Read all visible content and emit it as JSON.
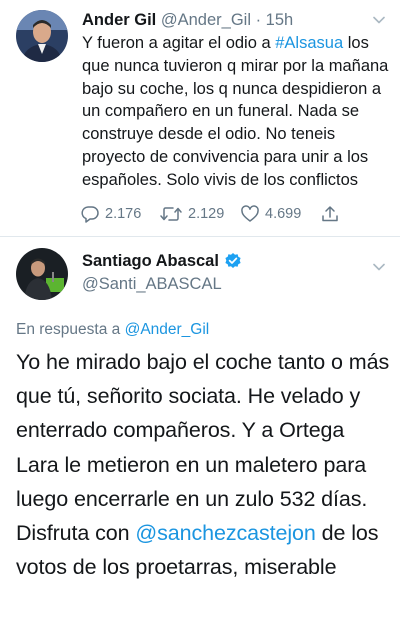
{
  "tweet1": {
    "author_name": "Ander Gil",
    "handle": "@Ander_Gil",
    "separator": "·",
    "time": "15h",
    "text_parts": {
      "before_tag": "Y fueron a agitar el odio a ",
      "hashtag": "#Alsasua",
      "after_tag": " los que nunca tuvieron q mirar por la mañana bajo su coche, los q nunca despidieron a un compañero en un funeral. Nada se construye desde el odio. No teneis proyecto de convivencia para unir a los españoles. Solo vivis de los conflictos"
    },
    "stats": {
      "replies": "2.176",
      "retweets": "2.129",
      "likes": "4.699"
    }
  },
  "tweet2": {
    "author_name": "Santiago Abascal",
    "handle": "@Santi_ABASCAL",
    "reply_prefix": "En respuesta a ",
    "reply_handle": "@Ander_Gil",
    "text_parts": {
      "before_mention": "Yo he mirado bajo el coche tanto o más que tú, señorito sociata. He velado y enterrado compañeros. Y a Ortega Lara le metieron en un maletero para luego encerrarle en un zulo 532 días. Disfruta con ",
      "mention": "@sanchezcastejon",
      "after_mention": " de los votos de los proetarras, miserable"
    }
  },
  "colors": {
    "link": "#1b95e0",
    "muted": "#657786",
    "text": "#14171a",
    "verified": "#1da1f2",
    "divider": "#e1e8ed"
  },
  "icons": {
    "reply": "comment-bubble-icon",
    "retweet": "retweet-arrows-icon",
    "like": "heart-outline-icon",
    "share": "share-upload-icon",
    "menu": "chevron-down-icon",
    "verified": "verified-badge-icon"
  }
}
